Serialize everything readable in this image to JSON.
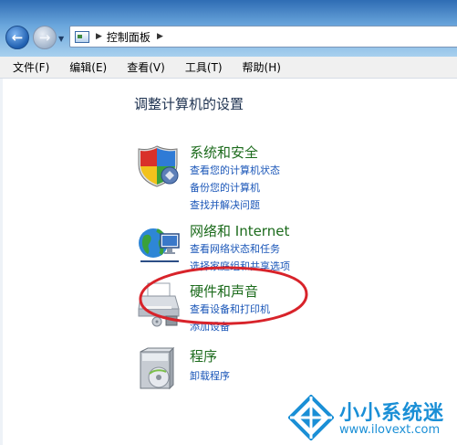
{
  "address": {
    "path": [
      "控制面板"
    ]
  },
  "menu": [
    {
      "label": "文件(F)"
    },
    {
      "label": "编辑(E)"
    },
    {
      "label": "查看(V)"
    },
    {
      "label": "工具(T)"
    },
    {
      "label": "帮助(H)"
    }
  ],
  "main": {
    "heading": "调整计算机的设置",
    "categories": [
      {
        "title": "系统和安全",
        "links": [
          "查看您的计算机状态",
          "备份您的计算机",
          "查找并解决问题"
        ],
        "icon": "shield-icon"
      },
      {
        "title": "网络和 Internet",
        "links": [
          "查看网络状态和任务",
          "选择家庭组和共享选项"
        ],
        "icon": "network-globe-icon"
      },
      {
        "title": "硬件和声音",
        "links": [
          "查看设备和打印机",
          "添加设备"
        ],
        "icon": "printer-icon"
      },
      {
        "title": "程序",
        "links": [
          "卸载程序"
        ],
        "icon": "programs-icon"
      }
    ]
  },
  "annotation": {
    "color": "#d8232a"
  },
  "watermark": {
    "name": "小小系统迷",
    "url": "www.ilovext.com"
  }
}
